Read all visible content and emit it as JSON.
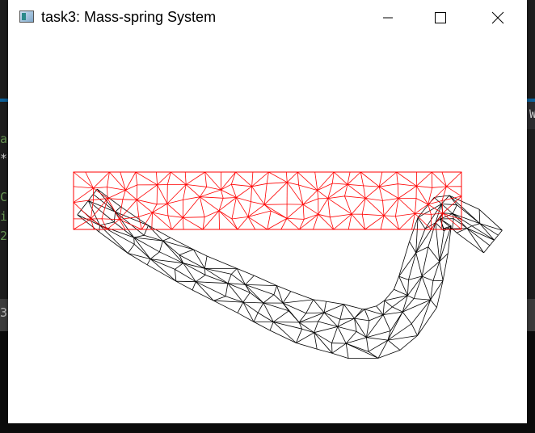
{
  "window": {
    "title": "task3: Mass-spring System",
    "controls": {
      "minimize": "minimize",
      "maximize": "maximize",
      "close": "close"
    }
  },
  "background": {
    "left_edge_chars": [
      {
        "text": "a",
        "color": "#6a9955"
      },
      {
        "text": "*",
        "color": "#cccccc"
      },
      {
        "text": "",
        "color": "#cccccc"
      },
      {
        "text": "C",
        "color": "#6a9955"
      },
      {
        "text": "i",
        "color": "#6a9955"
      },
      {
        "text": "2",
        "color": "#6a9955"
      }
    ],
    "panel_char": "3",
    "right_edge_char": "W"
  },
  "colors": {
    "rest_mesh": "#ff0000",
    "deformed_mesh": "#000000"
  }
}
